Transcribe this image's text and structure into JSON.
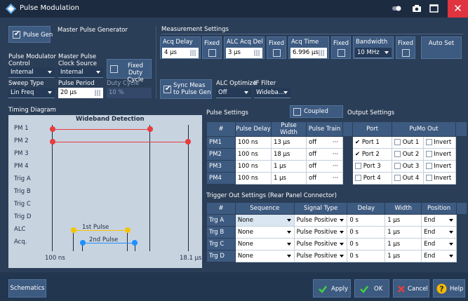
{
  "window": {
    "title": "Pulse Modulation",
    "close_label": "✕"
  },
  "master": {
    "pulse_gen_label": "Pulse Gen",
    "master_label": "Master Pulse Generator",
    "mod_control_label": "Pulse Modulator Control",
    "mod_control_value": "Internal",
    "clock_source_label": "Master Pulse Clock Source",
    "clock_source_value": "Internal",
    "fixed_duty_label": "Fixed Duty Cycle",
    "sweep_type_label": "Sweep Type",
    "sweep_type_value": "Lin Freq",
    "pulse_period_label": "Pulse Period",
    "pulse_period_value": "20 µs",
    "duty_cycle_label": "Duty Cycle",
    "duty_cycle_value": "10 %"
  },
  "measurement": {
    "title": "Measurement Settings",
    "acq_delay_label": "Acq Delay",
    "acq_delay_value": "4 µs",
    "fixed1": "Fixed",
    "alc_acq_label": "ALC Acq Del",
    "alc_acq_value": "3 µs",
    "fixed2": "Fixed",
    "acq_time_label": "Acq Time",
    "acq_time_value": "6.996 µs",
    "fixed3": "Fixed",
    "bandwidth_label": "Bandwidth",
    "bandwidth_value": "10 MHz",
    "fixed4": "Fixed",
    "auto_set_label": "Auto Set",
    "sync_label": "Sync Meas to Pulse Gen",
    "alc_opt_label": "ALC Optimize",
    "alc_opt_value": "Off",
    "if_filter_label": "IF Filter",
    "if_filter_value": "Wideba..."
  },
  "timing": {
    "title": "Timing Diagram",
    "header": "Wideband Detection",
    "rows": [
      "PM 1",
      "PM 2",
      "PM 3",
      "PM 4",
      "Trig A",
      "Trig B",
      "Trig C",
      "Trig D",
      "ALC",
      "Acq."
    ],
    "pulse1_label": "1st Pulse",
    "pulse2_label": "2nd Pulse",
    "start_label": "100 ns",
    "end_label": "18.1 µs"
  },
  "pulse_settings": {
    "title": "Pulse Settings",
    "coupled_label": "Coupled",
    "output_title": "Output Settings",
    "headers": [
      "#",
      "Pulse Delay",
      "Pulse Width",
      "Pulse Train",
      "",
      "Port",
      "PuMo Out"
    ],
    "rows": [
      {
        "name": "PM1",
        "delay": "100 ns",
        "width": "13 µs",
        "train": "off",
        "port": "Port 1",
        "out": "Out 1",
        "invert": "Invert"
      },
      {
        "name": "PM2",
        "delay": "100 ns",
        "width": "18 µs",
        "train": "off",
        "port": "Port 2",
        "out": "Out 2",
        "invert": "Invert"
      },
      {
        "name": "PM3",
        "delay": "100 ns",
        "width": "1 µs",
        "train": "off",
        "port": "Port 3",
        "out": "Out 3",
        "invert": "Invert"
      },
      {
        "name": "PM4",
        "delay": "100 ns",
        "width": "1 µs",
        "train": "off",
        "port": "Port 4",
        "out": "Out 4",
        "invert": "Invert"
      }
    ],
    "more": "···"
  },
  "trigger": {
    "title": "Trigger Out Settings (Rear Panel Connector)",
    "headers": [
      "#",
      "Sequence",
      "Signal Type",
      "Delay",
      "Width",
      "Position"
    ],
    "rows": [
      {
        "name": "Trg A",
        "seq": "None",
        "type": "Pulse Positive",
        "delay": "0 s",
        "width": "1 µs",
        "pos": "End"
      },
      {
        "name": "Trg B",
        "seq": "None",
        "type": "Pulse Positive",
        "delay": "0 s",
        "width": "1 µs",
        "pos": "End"
      },
      {
        "name": "Trg C",
        "seq": "None",
        "type": "Pulse Positive",
        "delay": "0 s",
        "width": "1 µs",
        "pos": "End"
      },
      {
        "name": "Trg D",
        "seq": "None",
        "type": "Pulse Positive",
        "delay": "0 s",
        "width": "1 µs",
        "pos": "End"
      }
    ]
  },
  "footer": {
    "schematics": "Schematics",
    "apply": "Apply",
    "ok": "OK",
    "cancel": "Cancel",
    "help": "Help"
  },
  "colors": {
    "pm_red": "#e83d3d",
    "pulse_yellow": "#f5c400",
    "pulse_blue": "#1e90ff"
  }
}
